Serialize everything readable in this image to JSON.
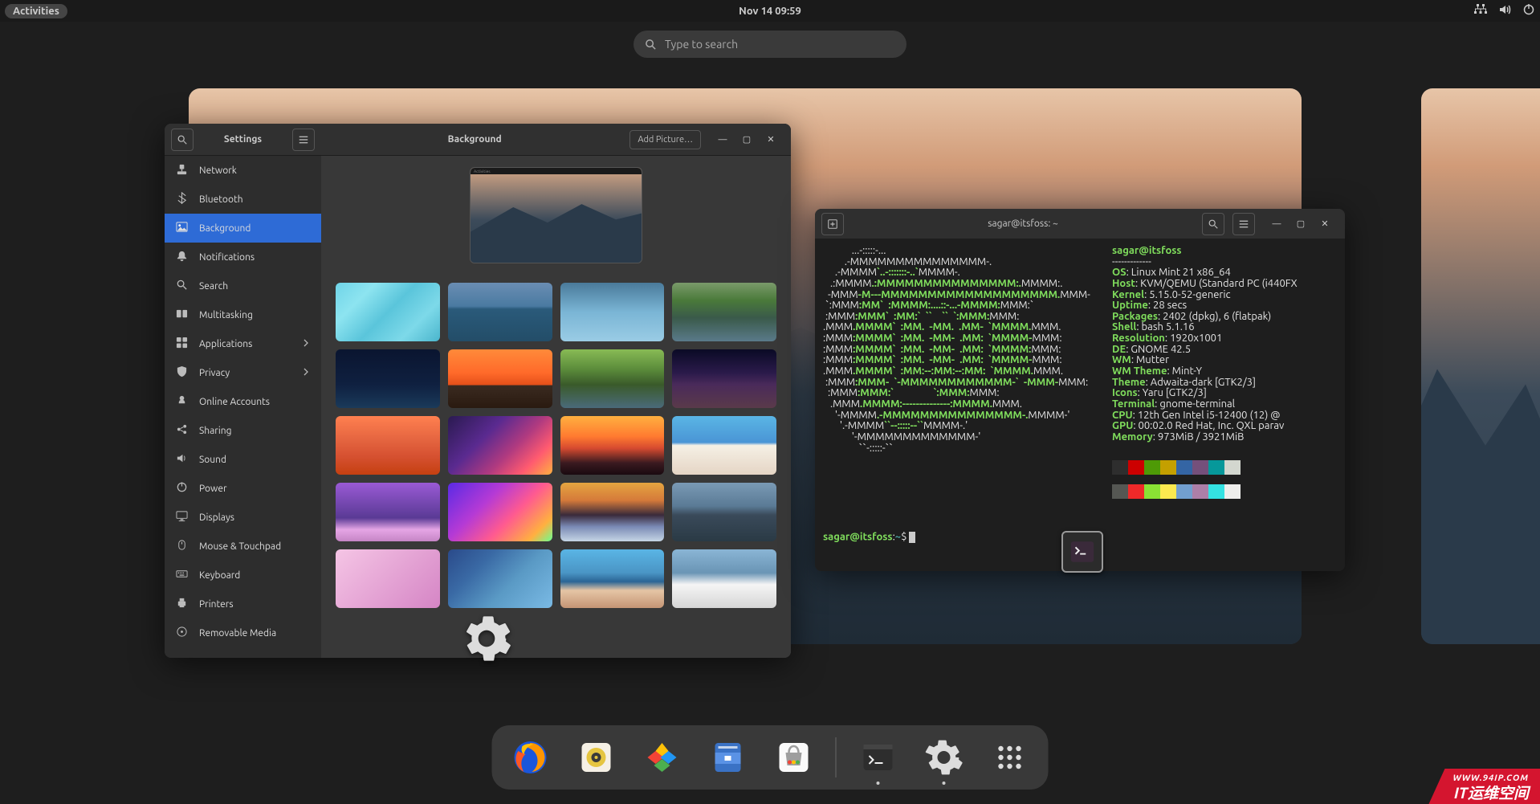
{
  "topbar": {
    "activities": "Activities",
    "clock": "Nov 14  09:59"
  },
  "search": {
    "placeholder": "Type to search"
  },
  "settings": {
    "title": "Settings",
    "header": "Background",
    "addPicture": "Add Picture…",
    "items": [
      {
        "label": "Network"
      },
      {
        "label": "Bluetooth"
      },
      {
        "label": "Background",
        "active": true
      },
      {
        "label": "Notifications"
      },
      {
        "label": "Search"
      },
      {
        "label": "Multitasking"
      },
      {
        "label": "Applications",
        "chev": true
      },
      {
        "label": "Privacy",
        "chev": true
      },
      {
        "label": "Online Accounts"
      },
      {
        "label": "Sharing"
      },
      {
        "label": "Sound"
      },
      {
        "label": "Power"
      },
      {
        "label": "Displays"
      },
      {
        "label": "Mouse & Touchpad"
      },
      {
        "label": "Keyboard"
      },
      {
        "label": "Printers"
      },
      {
        "label": "Removable Media"
      }
    ],
    "previewBar": "Activities",
    "wallpapers": [
      "linear-gradient(135deg,#6fd4e8 0%,#8de4f0 25%,#5ac5db 50%,#7dd9e9 75%,#4ab5cc 100%)",
      "linear-gradient(180deg,#6a8db3 0%,#4a7aa1 40%,#2a5a7a 45%,#234d68 100%)",
      "linear-gradient(180deg,#4a7a9a 0%,#7ab5d5 50%,#9acce5 100%)",
      "linear-gradient(180deg,#7a9a6a 0%,#4a7a3a 30%,#3a5a4a 60%,#5a7a8a 100%)",
      "linear-gradient(180deg,#0a1530 0%,#0f2040 60%,#1a3a5a 100%)",
      "linear-gradient(180deg,#ff8a3a 0%,#ff6a2a 40%,#e5501a 60%,#3a2a20 62%,#2a1a10 100%)",
      "linear-gradient(180deg,#88bb55 0%,#5a8a3a 35%,#3a5a2a 60%,#4a6a7a 100%)",
      "linear-gradient(180deg,#0a0a25 0%,#2a1a4a 40%,#4a2a5a 60%,#5a3a4a 100%)",
      "linear-gradient(180deg,#ff8050 0%,#e56540 40%,#d55030 70%,#c54010 100%)",
      "linear-gradient(135deg,#2a1a50 0%,#5a2a90 35%,#b03a80 60%,#ff5a70 80%,#ffb040 100%)",
      "linear-gradient(180deg,#ffb040 0%,#ff7a30 35%,#d54a30 55%,#3a1a20 80%,#1a0a10 100%)",
      "linear-gradient(180deg,#5ab5e5 0%,#4a95d5 45%,#f5f0e5 50%,#e5d5c5 100%)",
      "linear-gradient(180deg,#9a5ad5 0%,#7a4ab5 30%,#5a3a95 60%,#e5a5e5 80%,#c585c5 100%)",
      "linear-gradient(135deg,#5a2ae5 0%,#b53ad5 35%,#ff5a90 60%,#ffb040 85%,#6aff90 100%)",
      "linear-gradient(180deg,#e5a540 0%,#d57a3a 30%,#3a2a3a 55%,#7a8ab5 75%,#c5d5e5 100%)",
      "linear-gradient(180deg,#7a9ab5 0%,#5a7a95 40%,#3a4a5a 55%,#2a3a45 100%)",
      "linear-gradient(135deg,#f5c5e5 0%,#e5a5d5 50%,#d585c5 100%)",
      "linear-gradient(135deg,#2a4a8a 0%,#3a6aa5 30%,#5a9ac5 60%,#7abae5 100%)",
      "linear-gradient(180deg,#5ab5e5 0%,#4a95c5 40%,#2a6595 55%,#e5c5a5 70%,#c59575 100%)",
      "linear-gradient(180deg,#8ab5d5 0%,#6a95b5 40%,#f5f5f5 60%,#d5d5d5 100%)"
    ]
  },
  "terminal": {
    "title": "sagar@itsfoss: ~",
    "userhost": "sagar@itsfoss",
    "neofetch": {
      "OS": "Linux Mint 21 x86_64",
      "Host": "KVM/QEMU (Standard PC (i440FX",
      "Kernel": "5.15.0-52-generic",
      "Uptime": "28 secs",
      "Packages": "2402 (dpkg), 6 (flatpak)",
      "Shell": "bash 5.1.16",
      "Resolution": "1920x1001",
      "DE": "GNOME 42.5",
      "WM": "Mutter",
      "WM Theme": "Mint-Y",
      "Theme": "Adwaita-dark [GTK2/3]",
      "Icons": "Yaru [GTK2/3]",
      "Terminal": "gnome-terminal",
      "CPU": "12th Gen Intel i5-12400 (12) @",
      "GPU": "00:02.0 Red Hat, Inc. QXL parav",
      "Memory": "973MiB / 3921MiB"
    },
    "promptPath": "~",
    "promptChar": "$",
    "palette": [
      "#2e2e2e",
      "#cc0000",
      "#4e9a06",
      "#c4a000",
      "#3465a4",
      "#75507b",
      "#06989a",
      "#d3d7cf",
      "#555753",
      "#ef2929",
      "#8ae234",
      "#fce94f",
      "#729fcf",
      "#ad7fa8",
      "#34e2e2",
      "#eeeeec"
    ]
  },
  "watermark": {
    "l1": "WWW.94IP.COM",
    "l2": "IT运维空间"
  },
  "dock": {
    "apps": [
      "firefox",
      "rhythmbox",
      "photos",
      "files",
      "software"
    ],
    "running": [
      "terminal",
      "settings",
      "apps-grid"
    ]
  }
}
